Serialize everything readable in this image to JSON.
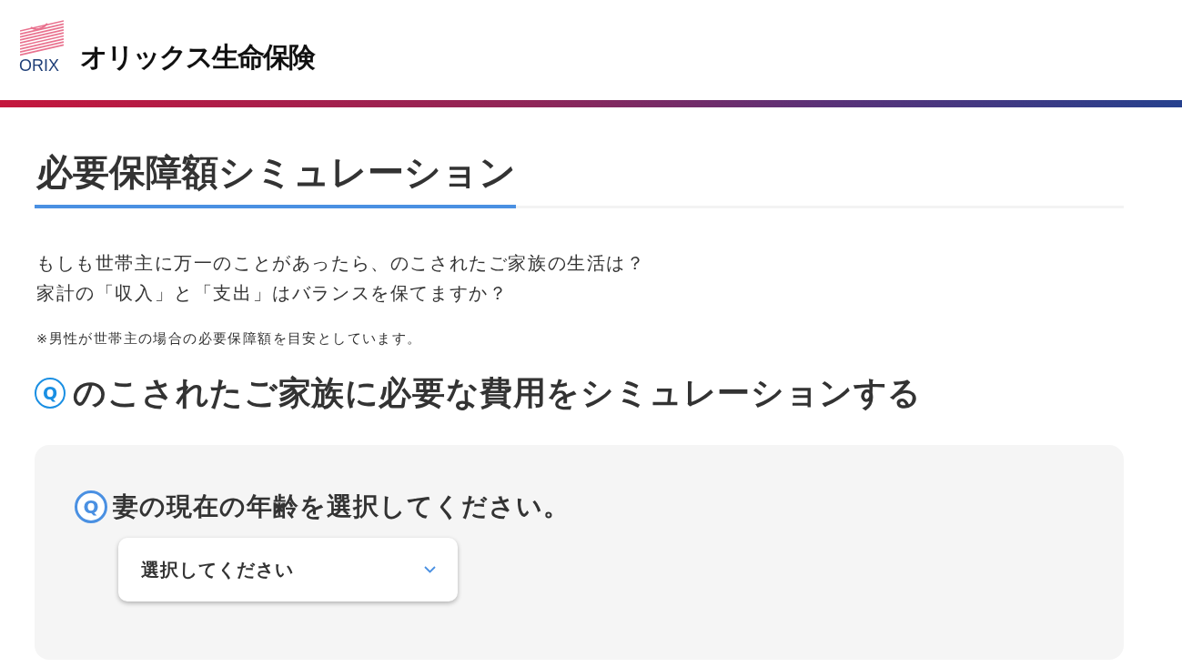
{
  "header": {
    "logo_wordmark": "ORIX",
    "company_name": "オリックス生命保険"
  },
  "page_title": "必要保障額シミュレーション",
  "intro": [
    "もしも世帯主に万一のことがあったら、のこされたご家族の生活は？",
    "家計の「収入」と「支出」はバランスを保てますか？"
  ],
  "note": "※男性が世帯主の場合の必要保障額を目安としています。",
  "section": {
    "badge": "Q",
    "heading": "のこされたご家族に必要な費用をシミュレーションする"
  },
  "questions": [
    {
      "badge": "Q",
      "text": "妻の現在の年齢を選択してください。",
      "select": {
        "placeholder": "選択してください"
      }
    }
  ]
}
